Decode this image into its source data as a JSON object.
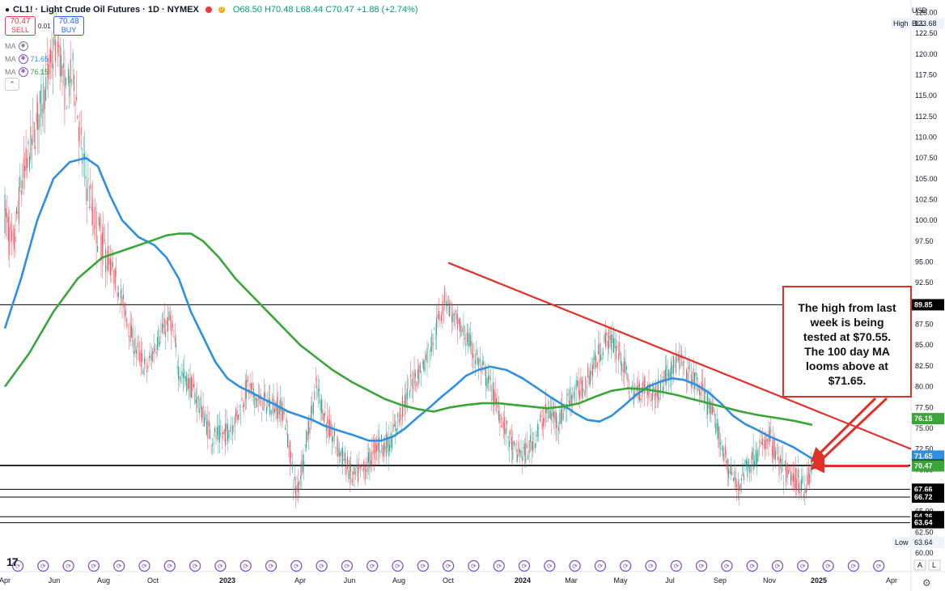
{
  "header": {
    "symbol_dot": "●",
    "title": "CL1! · Light Crude Oil Futures · 1D · NYMEX",
    "badge_d": "D",
    "ohlc": "O68.50 H70.48 L68.44 C70.47 +1.88 (+2.74%)"
  },
  "trade": {
    "sell_price": "70.47",
    "sell_label": "SELL",
    "spread": "0.01",
    "buy_price": "70.48",
    "buy_label": "BUY"
  },
  "indicators": [
    {
      "label": "MA",
      "value": ""
    },
    {
      "label": "MA",
      "value": "71.65",
      "color": "#2f8fe0"
    },
    {
      "label": "MA",
      "value": "76.15",
      "color": "#3aa63a"
    }
  ],
  "axis_top": {
    "currency": "USD",
    "unit": "BLL"
  },
  "annotation": {
    "text_lines": [
      "The high from last",
      "week is being",
      "tested at $70.55.",
      "The 100 day MA",
      "looms above at",
      "$71.65."
    ]
  },
  "colors": {
    "up": "#089981",
    "down": "#f23645",
    "ma100": "#2f8fe0",
    "ma200": "#3aa63a",
    "trend": "#e0302a"
  },
  "chart_data": {
    "type": "line",
    "y_axis_ticks": [
      60.0,
      62.5,
      65.0,
      67.5,
      70.0,
      72.5,
      75.0,
      77.5,
      80.0,
      82.5,
      85.0,
      87.5,
      90.0,
      92.5,
      95.0,
      97.5,
      100.0,
      102.5,
      105.0,
      107.5,
      110.0,
      112.5,
      115.0,
      117.5,
      120.0,
      122.5,
      125.0
    ],
    "ylim": [
      60,
      126.5
    ],
    "x_axis_labels": [
      {
        "label": "Apr",
        "t": 0
      },
      {
        "label": "Jun",
        "t": 61
      },
      {
        "label": "Aug",
        "t": 122
      },
      {
        "label": "Oct",
        "t": 183
      },
      {
        "label": "2023",
        "t": 275
      },
      {
        "label": "Apr",
        "t": 365
      },
      {
        "label": "Jun",
        "t": 426
      },
      {
        "label": "Aug",
        "t": 487
      },
      {
        "label": "Oct",
        "t": 548
      },
      {
        "label": "2024",
        "t": 640
      },
      {
        "label": "Mar",
        "t": 700
      },
      {
        "label": "May",
        "t": 761
      },
      {
        "label": "Jul",
        "t": 822
      },
      {
        "label": "Sep",
        "t": 884
      },
      {
        "label": "Nov",
        "t": 945
      },
      {
        "label": "2025",
        "t": 1006
      },
      {
        "label": "Apr",
        "t": 1096
      }
    ],
    "price_path": [
      [
        0,
        101
      ],
      [
        10,
        96
      ],
      [
        20,
        104
      ],
      [
        35,
        110
      ],
      [
        50,
        116
      ],
      [
        65,
        122
      ],
      [
        75,
        115
      ],
      [
        85,
        118
      ],
      [
        95,
        108
      ],
      [
        110,
        100
      ],
      [
        125,
        96
      ],
      [
        140,
        92
      ],
      [
        160,
        85
      ],
      [
        175,
        82
      ],
      [
        190,
        86
      ],
      [
        205,
        88
      ],
      [
        215,
        82
      ],
      [
        230,
        80
      ],
      [
        240,
        78
      ],
      [
        255,
        74
      ],
      [
        270,
        74
      ],
      [
        285,
        76
      ],
      [
        300,
        80
      ],
      [
        315,
        78
      ],
      [
        330,
        78
      ],
      [
        345,
        77
      ],
      [
        360,
        67
      ],
      [
        370,
        72
      ],
      [
        385,
        80
      ],
      [
        400,
        75
      ],
      [
        415,
        72
      ],
      [
        430,
        69
      ],
      [
        445,
        70
      ],
      [
        460,
        73
      ],
      [
        475,
        73
      ],
      [
        490,
        77
      ],
      [
        505,
        81
      ],
      [
        515,
        82
      ],
      [
        530,
        86
      ],
      [
        545,
        91
      ],
      [
        555,
        88
      ],
      [
        570,
        86
      ],
      [
        585,
        83
      ],
      [
        600,
        80
      ],
      [
        615,
        76
      ],
      [
        630,
        72
      ],
      [
        645,
        72
      ],
      [
        655,
        74
      ],
      [
        670,
        77
      ],
      [
        685,
        76
      ],
      [
        700,
        79
      ],
      [
        715,
        80
      ],
      [
        730,
        83
      ],
      [
        745,
        86
      ],
      [
        760,
        84
      ],
      [
        775,
        79
      ],
      [
        790,
        80
      ],
      [
        805,
        79
      ],
      [
        820,
        82
      ],
      [
        835,
        83
      ],
      [
        850,
        81
      ],
      [
        865,
        79
      ],
      [
        880,
        75
      ],
      [
        895,
        70
      ],
      [
        905,
        68
      ],
      [
        915,
        70
      ],
      [
        930,
        72
      ],
      [
        945,
        74
      ],
      [
        960,
        70
      ],
      [
        975,
        69
      ],
      [
        990,
        68
      ],
      [
        998,
        70.47
      ]
    ],
    "series": [
      {
        "name": "MA",
        "values": [
          [
            0,
            87
          ],
          [
            20,
            93
          ],
          [
            40,
            100
          ],
          [
            60,
            105
          ],
          [
            80,
            107
          ],
          [
            100,
            107.5
          ],
          [
            115,
            106.5
          ],
          [
            130,
            103
          ],
          [
            145,
            100
          ],
          [
            165,
            98
          ],
          [
            185,
            97
          ],
          [
            200,
            95.5
          ],
          [
            215,
            93
          ],
          [
            230,
            89
          ],
          [
            245,
            86
          ],
          [
            260,
            83
          ],
          [
            275,
            81
          ],
          [
            290,
            80
          ],
          [
            305,
            79.3
          ],
          [
            320,
            78.5
          ],
          [
            335,
            77.8
          ],
          [
            350,
            77
          ],
          [
            365,
            76.5
          ],
          [
            380,
            76
          ],
          [
            395,
            75.3
          ],
          [
            410,
            74.8
          ],
          [
            430,
            74.2
          ],
          [
            450,
            73.5
          ],
          [
            465,
            73.5
          ],
          [
            480,
            74
          ],
          [
            495,
            75
          ],
          [
            510,
            76.3
          ],
          [
            525,
            77.5
          ],
          [
            540,
            78.8
          ],
          [
            555,
            80
          ],
          [
            570,
            81.3
          ],
          [
            585,
            82
          ],
          [
            600,
            82.4
          ],
          [
            620,
            82
          ],
          [
            640,
            81
          ],
          [
            660,
            79.7
          ],
          [
            675,
            78.7
          ],
          [
            690,
            77.8
          ],
          [
            705,
            76.8
          ],
          [
            720,
            76
          ],
          [
            735,
            75.8
          ],
          [
            750,
            76.5
          ],
          [
            765,
            77.7
          ],
          [
            780,
            79
          ],
          [
            795,
            80
          ],
          [
            810,
            80.6
          ],
          [
            825,
            81
          ],
          [
            840,
            80.8
          ],
          [
            855,
            80.2
          ],
          [
            870,
            79.3
          ],
          [
            885,
            78
          ],
          [
            900,
            76.5
          ],
          [
            915,
            75.5
          ],
          [
            930,
            74.8
          ],
          [
            945,
            74
          ],
          [
            960,
            73.4
          ],
          [
            975,
            72.7
          ],
          [
            990,
            71.8
          ],
          [
            998,
            71.3
          ]
        ]
      },
      {
        "name": "MA",
        "values": [
          [
            0,
            80
          ],
          [
            30,
            84
          ],
          [
            60,
            89
          ],
          [
            90,
            93
          ],
          [
            120,
            95.5
          ],
          [
            150,
            96.5
          ],
          [
            180,
            97.5
          ],
          [
            200,
            98.2
          ],
          [
            215,
            98.4
          ],
          [
            230,
            98.4
          ],
          [
            245,
            97.5
          ],
          [
            265,
            95.5
          ],
          [
            285,
            93
          ],
          [
            305,
            91
          ],
          [
            325,
            89
          ],
          [
            345,
            87
          ],
          [
            365,
            85
          ],
          [
            385,
            83.5
          ],
          [
            405,
            82
          ],
          [
            430,
            80.5
          ],
          [
            450,
            79.5
          ],
          [
            470,
            78.5
          ],
          [
            490,
            77.8
          ],
          [
            510,
            77.3
          ],
          [
            530,
            77
          ],
          [
            550,
            77.5
          ],
          [
            570,
            77.8
          ],
          [
            590,
            78
          ],
          [
            610,
            78
          ],
          [
            630,
            77.8
          ],
          [
            650,
            77.6
          ],
          [
            670,
            77.4
          ],
          [
            690,
            77.6
          ],
          [
            710,
            78
          ],
          [
            730,
            78.8
          ],
          [
            750,
            79.5
          ],
          [
            770,
            79.8
          ],
          [
            790,
            79.7
          ],
          [
            810,
            79.4
          ],
          [
            830,
            79
          ],
          [
            850,
            78.5
          ],
          [
            870,
            78
          ],
          [
            890,
            77.5
          ],
          [
            910,
            77
          ],
          [
            930,
            76.6
          ],
          [
            950,
            76.3
          ],
          [
            975,
            75.9
          ],
          [
            998,
            75.4
          ]
        ]
      }
    ],
    "horizontal_levels": [
      89.85,
      70.55,
      70.47,
      67.66,
      66.72,
      64.36,
      63.64
    ],
    "trend_line": {
      "from": [
        548,
        94.9
      ],
      "to": [
        1120,
        72.5
      ]
    },
    "price_labels": [
      {
        "text": "123.68",
        "value": 123.68,
        "kind": "plain"
      },
      {
        "text": "89.85",
        "value": 89.85,
        "kind": "black"
      },
      {
        "text": "76.15",
        "value": 76.15,
        "kind": "green"
      },
      {
        "text": "71.65",
        "value": 71.65,
        "kind": "blue"
      },
      {
        "text": "70.55",
        "value": 70.55,
        "kind": "black"
      },
      {
        "text": "70.47",
        "value": 70.47,
        "kind": "green"
      },
      {
        "text": "67.66",
        "value": 67.66,
        "kind": "black"
      },
      {
        "text": "66.72",
        "value": 66.72,
        "kind": "black"
      },
      {
        "text": "64.36",
        "value": 64.36,
        "kind": "black"
      },
      {
        "text": "63.64",
        "value": 63.64,
        "kind": "black"
      },
      {
        "text": "63.64",
        "value": 63.64,
        "kind": "plain"
      }
    ],
    "side_tags": {
      "high": "High",
      "low": "Low"
    },
    "high_value": 123.68,
    "low_value": 63.64
  },
  "footer": {
    "logo": "17",
    "auto": "A",
    "log": "L"
  }
}
